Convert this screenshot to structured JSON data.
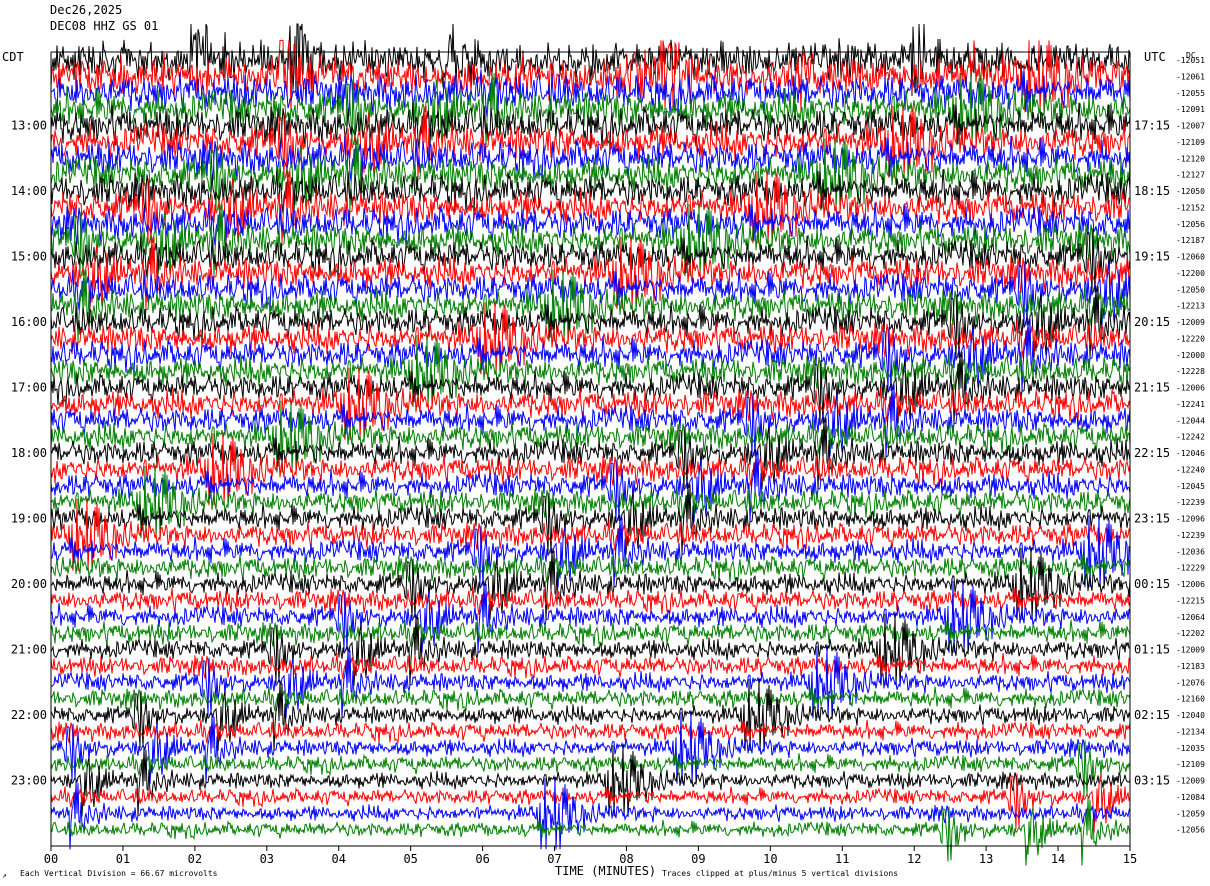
{
  "header": {
    "date": "Dec26,2025",
    "station": "DEC08 HHZ GS 01"
  },
  "colors": [
    "#000000",
    "#ff0000",
    "#0000ff",
    "#008000"
  ],
  "chart_data": {
    "type": "helicorder",
    "date": "Dec26,2025",
    "station": "DEC08 HHZ GS 01",
    "left_axis_label": "CDT",
    "right_axis_label": "UTC",
    "right_top_label": "DC",
    "xlabel": "TIME (MINUTES)",
    "x_ticks": [
      "00",
      "01",
      "02",
      "03",
      "04",
      "05",
      "06",
      "07",
      "08",
      "09",
      "10",
      "11",
      "12",
      "13",
      "14",
      "15"
    ],
    "xlim": [
      0,
      15
    ],
    "left_hour_labels": [
      "13:00",
      "14:00",
      "15:00",
      "16:00",
      "17:00",
      "18:00",
      "19:00",
      "20:00",
      "21:00",
      "22:00",
      "23:00"
    ],
    "right_hour_labels": [
      "17:15",
      "18:15",
      "19:15",
      "20:15",
      "21:15",
      "22:15",
      "23:15",
      "00:15",
      "01:15",
      "02:15",
      "03:15"
    ],
    "traces_per_hour": 4,
    "trace_count": 48,
    "dc_offsets": [
      "-12051",
      "-12061",
      "-12055",
      "-12091",
      "-12007",
      "-12109",
      "-12120",
      "-12127",
      "-12050",
      "-12152",
      "-12056",
      "-12187",
      "-12060",
      "-12200",
      "-12050",
      "-12213",
      "-12009",
      "-12220",
      "-12000",
      "-12228",
      "-12006",
      "-12241",
      "-12044",
      "-12242",
      "-12046",
      "-12240",
      "-12045",
      "-12239",
      "-12096",
      "-12239",
      "-12036",
      "-12229",
      "-12006",
      "-12215",
      "-12064",
      "-12202",
      "-12009",
      "-12183",
      "-12076",
      "-12160",
      "-12040",
      "-12134",
      "-12035",
      "-12109",
      "-12009",
      "-12084",
      "-12059",
      "-12056"
    ],
    "footer_left": "Each Vertical Division =   66.67 microvolts",
    "footer_right": "Traces clipped at plus/minus 5 vertical divisions",
    "corner_mark": "↗"
  }
}
